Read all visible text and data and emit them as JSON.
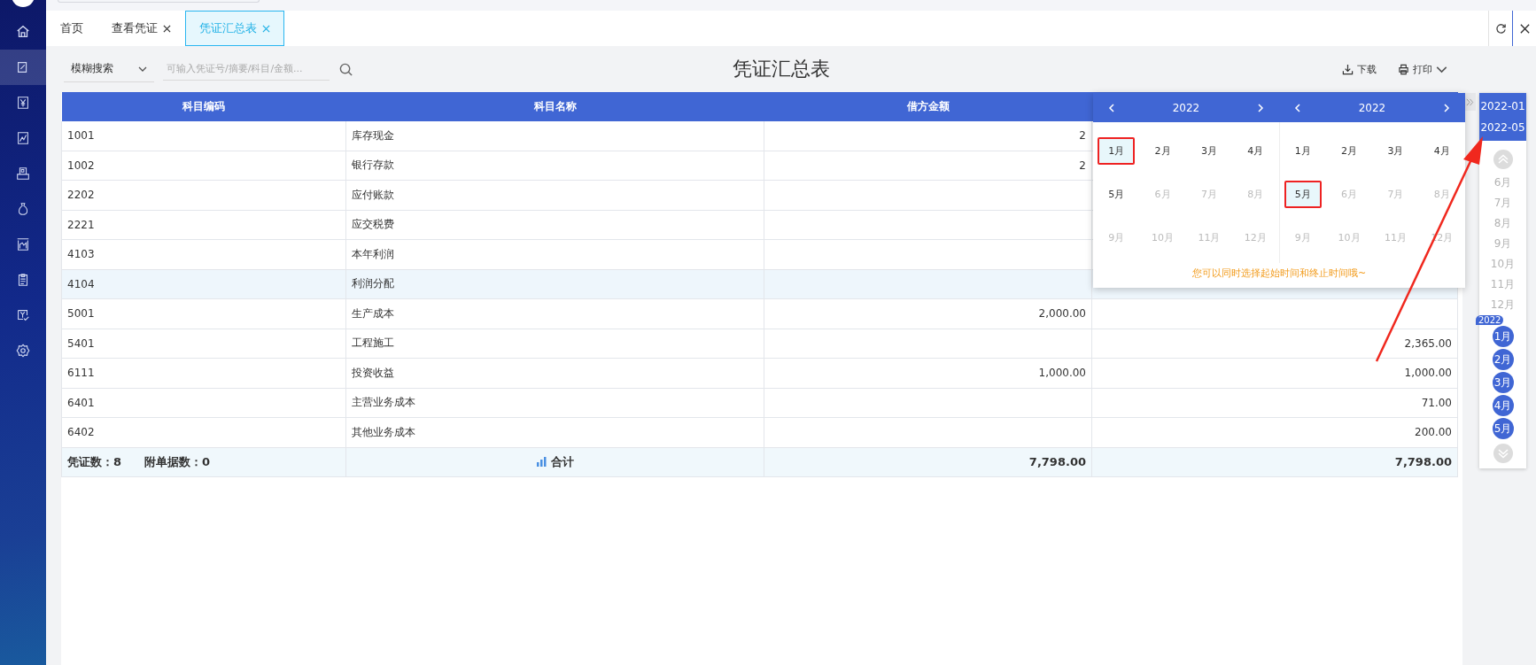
{
  "tabs": [
    {
      "label": "首页",
      "closable": false,
      "selected": false
    },
    {
      "label": "查看凭证",
      "closable": true,
      "selected": false
    },
    {
      "label": "凭证汇总表",
      "closable": true,
      "selected": true
    }
  ],
  "toolbar": {
    "search_mode": "模糊搜索",
    "search_placeholder": "可输入凭证号/摘要/科目/金额...",
    "title": "凭证汇总表",
    "download": "下载",
    "print": "打印"
  },
  "table": {
    "columns": [
      "科目编码",
      "科目名称",
      "借方金额"
    ],
    "rows": [
      {
        "code": "1001",
        "name": "库存现金",
        "debit": "2",
        "credit": "",
        "selected": false
      },
      {
        "code": "1002",
        "name": "银行存款",
        "debit": "2",
        "credit": "",
        "selected": false
      },
      {
        "code": "2202",
        "name": "应付账款",
        "debit": "",
        "credit": "",
        "selected": false
      },
      {
        "code": "2221",
        "name": "应交税费",
        "debit": "",
        "credit": "",
        "selected": false
      },
      {
        "code": "4103",
        "name": "本年利润",
        "debit": "",
        "credit": "",
        "selected": false
      },
      {
        "code": "4104",
        "name": "利润分配",
        "debit": "",
        "credit": "",
        "selected": true
      },
      {
        "code": "5001",
        "name": "生产成本",
        "debit": "2,000.00",
        "credit": "",
        "selected": false
      },
      {
        "code": "5401",
        "name": "工程施工",
        "debit": "",
        "credit": "2,365.00",
        "selected": false
      },
      {
        "code": "6111",
        "name": "投资收益",
        "debit": "1,000.00",
        "credit": "1,000.00",
        "selected": false
      },
      {
        "code": "6401",
        "name": "主营业务成本",
        "debit": "",
        "credit": "71.00",
        "selected": false
      },
      {
        "code": "6402",
        "name": "其他业务成本",
        "debit": "",
        "credit": "200.00",
        "selected": false
      }
    ],
    "footer": {
      "voucher_count": "凭证数：8",
      "attachment_count": "附单据数：0",
      "total_label": "合计",
      "debit_total": "7,798.00",
      "credit_total": "7,798.00"
    }
  },
  "date_picker": {
    "panels": [
      {
        "year": "2022",
        "months": [
          {
            "label": "1月",
            "selected": true,
            "disabled": false
          },
          {
            "label": "2月",
            "selected": false,
            "disabled": false
          },
          {
            "label": "3月",
            "selected": false,
            "disabled": false
          },
          {
            "label": "4月",
            "selected": false,
            "disabled": false
          },
          {
            "label": "5月",
            "selected": false,
            "disabled": false
          },
          {
            "label": "6月",
            "selected": false,
            "disabled": true
          },
          {
            "label": "7月",
            "selected": false,
            "disabled": true
          },
          {
            "label": "8月",
            "selected": false,
            "disabled": true
          },
          {
            "label": "9月",
            "selected": false,
            "disabled": true
          },
          {
            "label": "10月",
            "selected": false,
            "disabled": true
          },
          {
            "label": "11月",
            "selected": false,
            "disabled": true
          },
          {
            "label": "12月",
            "selected": false,
            "disabled": true
          }
        ]
      },
      {
        "year": "2022",
        "months": [
          {
            "label": "1月",
            "selected": false,
            "disabled": false
          },
          {
            "label": "2月",
            "selected": false,
            "disabled": false
          },
          {
            "label": "3月",
            "selected": false,
            "disabled": false
          },
          {
            "label": "4月",
            "selected": false,
            "disabled": false
          },
          {
            "label": "5月",
            "selected": true,
            "disabled": false
          },
          {
            "label": "6月",
            "selected": false,
            "disabled": true
          },
          {
            "label": "7月",
            "selected": false,
            "disabled": true
          },
          {
            "label": "8月",
            "selected": false,
            "disabled": true
          },
          {
            "label": "9月",
            "selected": false,
            "disabled": true
          },
          {
            "label": "10月",
            "selected": false,
            "disabled": true
          },
          {
            "label": "11月",
            "selected": false,
            "disabled": true
          },
          {
            "label": "12月",
            "selected": false,
            "disabled": true
          }
        ]
      }
    ],
    "hint": "您可以同时选择起始时间和终止时间哦~"
  },
  "period_panel": {
    "start": "2022-01",
    "end": "2022-05",
    "months": [
      {
        "label": "6月",
        "selected": false
      },
      {
        "label": "7月",
        "selected": false
      },
      {
        "label": "8月",
        "selected": false
      },
      {
        "label": "9月",
        "selected": false
      },
      {
        "label": "10月",
        "selected": false
      },
      {
        "label": "11月",
        "selected": false
      },
      {
        "label": "12月",
        "selected": false
      },
      {
        "label": "1月",
        "selected": true,
        "year": "2022"
      },
      {
        "label": "2月",
        "selected": true
      },
      {
        "label": "3月",
        "selected": true
      },
      {
        "label": "4月",
        "selected": true
      },
      {
        "label": "5月",
        "selected": true
      }
    ]
  }
}
